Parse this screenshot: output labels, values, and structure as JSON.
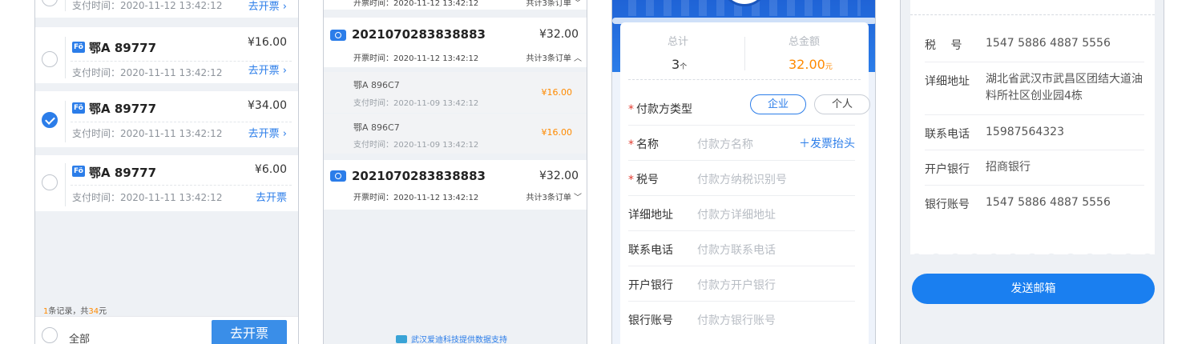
{
  "screen1": {
    "top_partial": {
      "pay_time": "支付时间：2020-11-12 13:42:12",
      "go_invoice": "去开票 ›"
    },
    "items": [
      {
        "plate": "鄂A 89777",
        "amount": "¥16.00",
        "pay_time": "支付时间：2020-11-11 13:42:12",
        "go_invoice": "去开票 ›",
        "checked": false
      },
      {
        "plate": "鄂A 89777",
        "amount": "¥34.00",
        "pay_time": "支付时间：2020-11-11 13:42:12",
        "go_invoice": "去开票 ›",
        "checked": true
      },
      {
        "plate": "鄂A 89777",
        "amount": "¥6.00",
        "pay_time": "支付时间：2020-11-11 13:42:12",
        "go_invoice": "去开票",
        "checked": false
      }
    ],
    "plate_icon": "car-plate-icon",
    "summary_count": "1",
    "summary_mid": "条记录，共",
    "summary_amount": "34",
    "summary_unit": "元",
    "select_all": "全部",
    "go_invoice_button": "去开票"
  },
  "screen2": {
    "top_partial": {
      "invoice_time": "开票时间：2020-11-12 13:42:12",
      "count": "共计3条订单 ﹀"
    },
    "orders": [
      {
        "order_no": "2021070283838883",
        "amount": "¥32.00",
        "invoice_time": "开票时间：2020-11-12 13:42:12",
        "count": "共计3条订单 ︿"
      },
      {
        "order_no": "2021070283838883",
        "amount": "¥32.00",
        "invoice_time": "开票时间：2020-11-12 13:42:12",
        "count": "共计3条订单 ﹀"
      }
    ],
    "sub_items": [
      {
        "plate": "鄂A 896C7",
        "pay_time": "支付时间：2020-11-09 13:42:12",
        "amount": "¥16.00"
      },
      {
        "plate": "鄂A 896C7",
        "pay_time": "支付时间：2020-11-09 13:42:12",
        "amount": "¥16.00"
      }
    ],
    "support": "武汉爱迪科技提供数据支持"
  },
  "screen3": {
    "total_label": "总计",
    "total_value": "3",
    "total_unit": "个",
    "amount_label": "总金额",
    "amount_value": "32.00",
    "amount_unit": "元",
    "payer_type_label": "付款方类型",
    "type_company": "企业",
    "type_personal": "个人",
    "name_label": "名称",
    "name_placeholder": "付款方名称",
    "add_title": "＋发票抬头",
    "tax_label": "税号",
    "tax_placeholder": "付款方纳税识别号",
    "address_label": "详细地址",
    "address_placeholder": "付款方详细地址",
    "phone_label": "联系电话",
    "phone_placeholder": "付款方联系电话",
    "bank_label": "开户银行",
    "bank_placeholder": "付款方开户银行",
    "account_label": "银行账号",
    "account_placeholder": "付款方银行账号"
  },
  "screen4": {
    "tax_label": "税　 号",
    "tax_value": "1547 5886 4887 5556",
    "address_label": "详细地址",
    "address_value": "湖北省武汉市武昌区团结大道油料所社区创业园4栋",
    "phone_label": "联系电话",
    "phone_value": "15987564323",
    "bank_label": "开户银行",
    "bank_value": "招商银行",
    "account_label": "银行账号",
    "account_value": "1547 5886 4887 5556",
    "send_button": "发送邮箱"
  }
}
